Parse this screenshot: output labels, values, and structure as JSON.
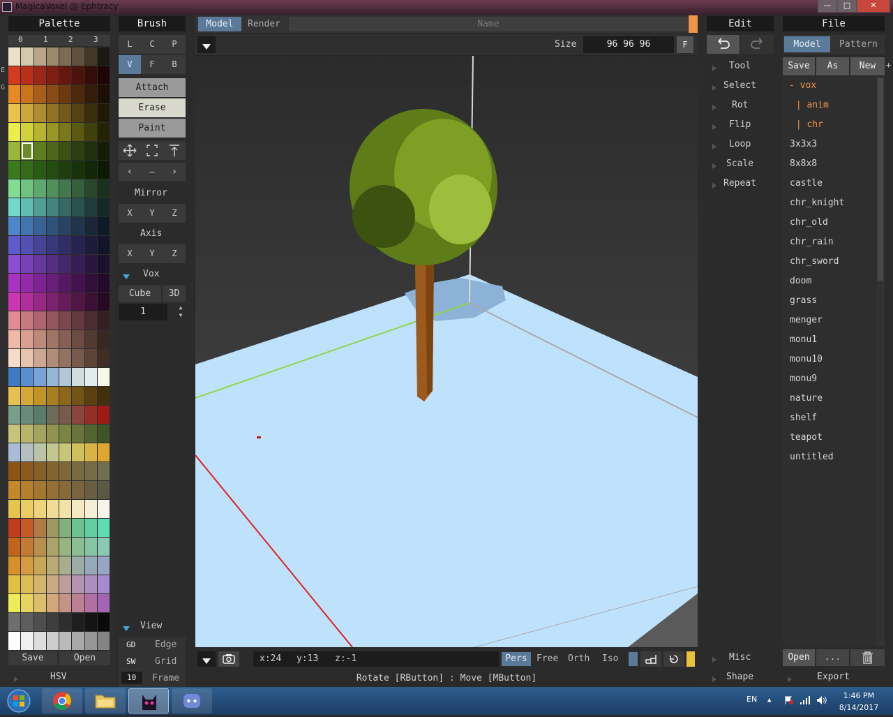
{
  "window": {
    "title": "MagicaVoxel @ Ephtracy",
    "minimize": "—",
    "maximize": "□",
    "close": "✕"
  },
  "palette": {
    "title": "Palette",
    "tabs": [
      "0",
      "1",
      "2",
      "3"
    ],
    "side_letters": [
      "E",
      "G"
    ],
    "save": "Save",
    "open": "Open",
    "hsv": "HSV",
    "rows": [
      [
        "#ece1c8",
        "#d6c8aa",
        "#b9a688",
        "#9c8a6c",
        "#7e6c52",
        "#5f513d",
        "#423829",
        "#1c1812"
      ],
      [
        "#d63a1e",
        "#b8301a",
        "#9a2718",
        "#801e14",
        "#661810",
        "#4c120c",
        "#340c08",
        "#1e0604"
      ],
      [
        "#e88a24",
        "#ca741c",
        "#a85e18",
        "#8a4c14",
        "#6c3a10",
        "#4e2a0c",
        "#341c08",
        "#1c1004"
      ],
      [
        "#e8c24a",
        "#cca83c",
        "#ae8e30",
        "#907424",
        "#725a1a",
        "#544210",
        "#3a2e0a",
        "#201a04"
      ],
      [
        "#ecec4a",
        "#d4d23c",
        "#b6b430",
        "#989624",
        "#7a781a",
        "#5c5a10",
        "#40400a",
        "#242404"
      ],
      [
        "#9ab43c",
        "#6c8a26",
        "#5e7c20",
        "#4c661a",
        "#3c5214",
        "#2e3e10",
        "#20300a",
        "#141c06"
      ],
      [
        "#3c7a1e",
        "#346a1a",
        "#2c5a16",
        "#244c12",
        "#1e3e0e",
        "#18320a",
        "#122608",
        "#0c1a04"
      ],
      [
        "#82dc92",
        "#70c280",
        "#60a86e",
        "#50905c",
        "#42784c",
        "#34603c",
        "#28482e",
        "#1c3020"
      ],
      [
        "#72d8cc",
        "#62bcb2",
        "#529e96",
        "#44847e",
        "#366a66",
        "#2a524e",
        "#1e3c3a",
        "#142826"
      ],
      [
        "#4e86cc",
        "#4474b0",
        "#3a6294",
        "#30527a",
        "#284262",
        "#20344c",
        "#182638",
        "#101a26"
      ],
      [
        "#5e5ccc",
        "#5250b0",
        "#464496",
        "#3a387c",
        "#302e64",
        "#26244e",
        "#1c1c3a",
        "#141428"
      ],
      [
        "#8a4ed2",
        "#7842b6",
        "#66389c",
        "#542e82",
        "#44266a",
        "#361e54",
        "#28163e",
        "#1c102a"
      ],
      [
        "#aa32c2",
        "#942aaa",
        "#7e2492",
        "#6a1e7a",
        "#561864",
        "#44124e",
        "#320e3a",
        "#220a28"
      ],
      [
        "#cc36b4",
        "#b22e9c",
        "#982886",
        "#7e2270",
        "#661c5a",
        "#501646",
        "#3a1034",
        "#260a22"
      ],
      [
        "#e08c92",
        "#c87880",
        "#ae666e",
        "#94565e",
        "#7c484e",
        "#643a3e",
        "#4c2c30",
        "#342022"
      ],
      [
        "#f0b8a6",
        "#d8a090",
        "#bc8a7a",
        "#a07466",
        "#866054",
        "#6c4c42",
        "#523a32",
        "#382824"
      ],
      [
        "#f6dcc8",
        "#e6c4ae",
        "#cca894",
        "#b08c7a",
        "#947262",
        "#785a4c",
        "#5c4438",
        "#402e26"
      ],
      [
        "#3e7ac6",
        "#5a8ed0",
        "#7aa2d6",
        "#96b6d6",
        "#b2c8da",
        "#cedcde",
        "#e2ecec",
        "#f6f8ec"
      ],
      [
        "#e8c050",
        "#d4a838",
        "#c09428",
        "#a87e20",
        "#8e681a",
        "#745414",
        "#5a400e",
        "#42300a"
      ],
      [
        "#789e8e",
        "#6a8a7c",
        "#5c7c6a",
        "#6c6c5a",
        "#7a5a4c",
        "#8a463a",
        "#962e28",
        "#9e1a16"
      ],
      [
        "#c8c47c",
        "#b8b46c",
        "#a4a460",
        "#909450",
        "#7c8444",
        "#68743a",
        "#546430",
        "#405426"
      ],
      [
        "#a8bcd8",
        "#b4c0c0",
        "#bcc4a8",
        "#c4c690",
        "#c8c674",
        "#d0c05c",
        "#d8b446",
        "#e0a632"
      ],
      [
        "#8e5414",
        "#8a5a1e",
        "#866028",
        "#826430",
        "#7e6838",
        "#7a6a40",
        "#766c48",
        "#726e50"
      ],
      [
        "#c4882a",
        "#b4802e",
        "#a47832",
        "#947036",
        "#866a3a",
        "#78643e",
        "#6a5e42",
        "#5c5846"
      ],
      [
        "#e4c44c",
        "#eacc64",
        "#eed47c",
        "#f0dc94",
        "#f2e2aa",
        "#f4e8c0",
        "#f6eed6",
        "#f8f4ea"
      ],
      [
        "#c03c1c",
        "#c45a2a",
        "#b07a44",
        "#9c9860",
        "#82b07a",
        "#6cc28e",
        "#62cea0",
        "#5edcb2"
      ],
      [
        "#c0641c",
        "#c47a34",
        "#b8904e",
        "#a8a46a",
        "#98b480",
        "#8cbe94",
        "#86c4a4",
        "#88c8b4"
      ],
      [
        "#d89028",
        "#d49c40",
        "#c8a65a",
        "#b8ac74",
        "#a8ae8e",
        "#9caca6",
        "#96a8ba",
        "#98a4c8"
      ],
      [
        "#e0c040",
        "#dcbc56",
        "#d4b46e",
        "#caa886",
        "#be9e9c",
        "#b494b0",
        "#ac8ec2",
        "#a88ad0"
      ],
      [
        "#eeec56",
        "#e6d460",
        "#dcbe6c",
        "#d2a878",
        "#c69486",
        "#bc8094",
        "#b070a4",
        "#a464b4"
      ],
      [
        "#6e6e6e",
        "#5e5e5e",
        "#4e4e4e",
        "#3e3e3e",
        "#2e2e2e",
        "#1e1e1e",
        "#141414",
        "#0a0a0a"
      ],
      [
        "#ffffff",
        "#f0f0f0",
        "#dedede",
        "#cccccc",
        "#bababa",
        "#a8a8a8",
        "#969696",
        "#848484"
      ]
    ],
    "selected_color": "#6c8a26"
  },
  "brush": {
    "title": "Brush",
    "row1": [
      "L",
      "C",
      "P"
    ],
    "row2": [
      "V",
      "F",
      "B"
    ],
    "attach": "Attach",
    "erase": "Erase",
    "paint": "Paint",
    "tool_icons": [
      "move-icon",
      "select-box-icon",
      "extrude-icon"
    ],
    "nav": [
      "‹",
      "—",
      "›"
    ],
    "mirror_label": "Mirror",
    "mirror": [
      "X",
      "Y",
      "Z"
    ],
    "axis_label": "Axis",
    "axis": [
      "X",
      "Y",
      "Z"
    ],
    "vox_label": "Vox",
    "cube": "Cube",
    "three_d": "3D",
    "stepper_value": "1",
    "view_label": "View",
    "view_rows": [
      {
        "key": "GD",
        "label": "Edge"
      },
      {
        "key": "SW",
        "label": "Grid"
      },
      {
        "key": "10",
        "label": "Frame"
      }
    ]
  },
  "viewport": {
    "tab_model": "Model",
    "tab_render": "Render",
    "name_placeholder": "Name",
    "size_label": "Size",
    "size_value": "96 96 96",
    "f_button": "F",
    "coords": {
      "x": "x:24",
      "y": "y:13",
      "z": "z:-1"
    },
    "projections": [
      "Pers",
      "Free",
      "Orth",
      "Iso"
    ],
    "status": "Rotate [RButton] : Move [MButton]"
  },
  "edit": {
    "title": "Edit",
    "items": [
      "Tool",
      "Select",
      "Rot",
      "Flip",
      "Loop",
      "Scale",
      "Repeat"
    ],
    "misc": "Misc",
    "shape": "Shape"
  },
  "file": {
    "title": "File",
    "tab_model": "Model",
    "tab_pattern": "Pattern",
    "save": "Save",
    "as": "As",
    "new": "New",
    "plus": "+",
    "folder_items": [
      "- vox",
      " | anim",
      " | chr"
    ],
    "items": [
      "3x3x3",
      "8x8x8",
      "castle",
      "chr_knight",
      "chr_old",
      "chr_rain",
      "chr_sword",
      "doom",
      "grass",
      "menger",
      "monu1",
      "monu10",
      "monu9",
      "nature",
      "shelf",
      "teapot",
      "untitled"
    ],
    "open": "Open",
    "dots": "...",
    "export": "Export"
  },
  "taskbar": {
    "lang": "EN",
    "time": "1:46 PM",
    "date": "8/14/2017"
  }
}
